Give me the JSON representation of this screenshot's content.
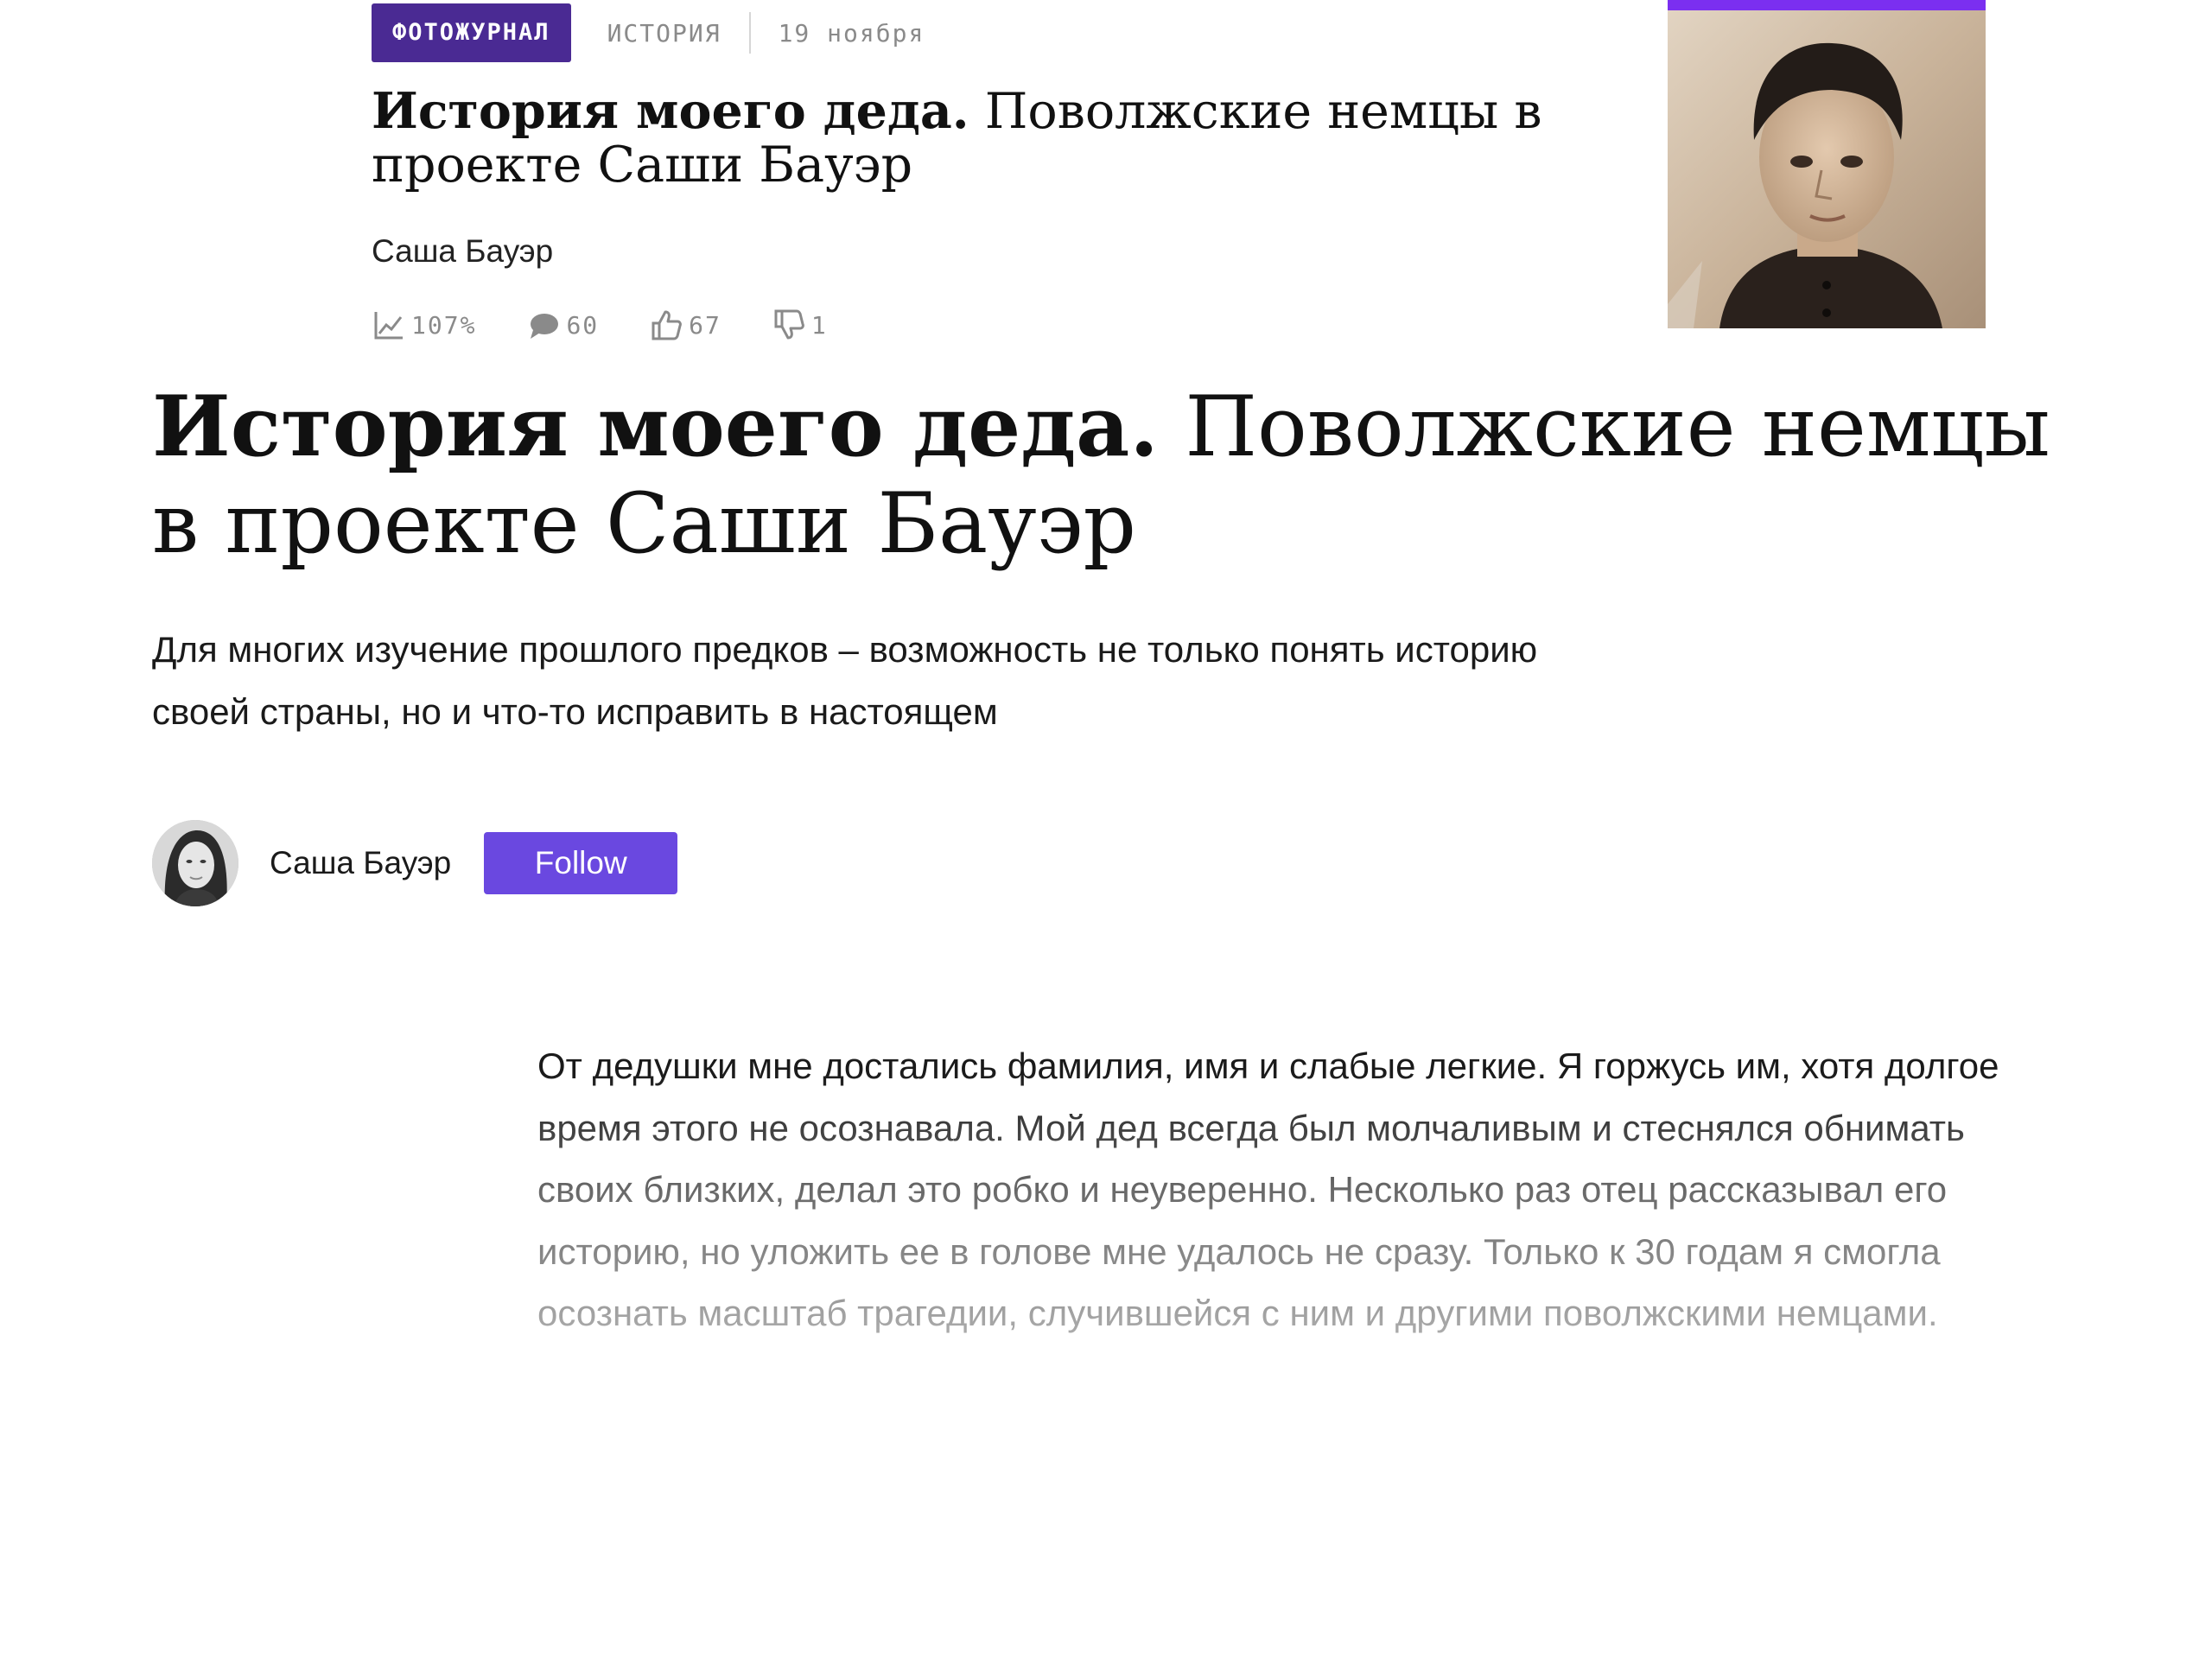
{
  "card": {
    "badge": "ФОТОЖУРНАЛ",
    "category": "ИСТОРИЯ",
    "date": "19 ноября",
    "title_bold": "История моего деда.",
    "title_rest": " Поволжские немцы в проекте Саши Бауэр",
    "author": "Саша Бауэр",
    "stats": {
      "views": "107%",
      "comments": "60",
      "likes": "67",
      "dislikes": "1"
    },
    "icons": [
      "chart-icon",
      "comment-icon",
      "thumbs-up-icon",
      "thumbs-down-icon"
    ]
  },
  "article": {
    "title_bold": "История моего деда.",
    "title_rest": " Поволжские немцы в проекте Саши Бауэр",
    "lead": "Для многих изучение прошлого предков – возможность не только понять историю своей страны, но и что-то исправить в настоящем",
    "author": "Саша Бауэр",
    "follow_label": "Follow",
    "body": "От дедушки мне достались фамилия, имя и слабые легкие. Я горжусь им, хотя долгое время этого не осознавала. Мой дед всегда был молчаливым и стеснялся обнимать своих близких, делал это робко и неуверенно. Несколько раз отец рассказывал его историю, но уложить ее в голове мне удалось не сразу. Только к 30 годам я смогла осознать масштаб трагедии, случившейся с ним и другими поволжскими немцами."
  },
  "colors": {
    "badge": "#4a2a93",
    "accent_bar": "#7b2ff0",
    "follow_button": "#6a48e0",
    "meta_text": "#8a8a8a"
  }
}
